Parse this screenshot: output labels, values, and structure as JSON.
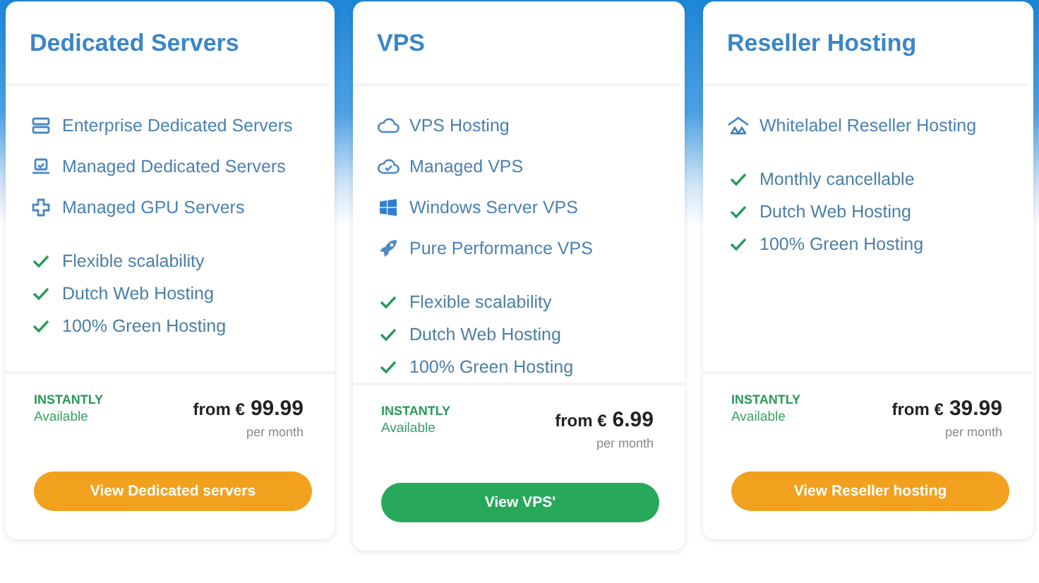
{
  "cards": [
    {
      "title": "Dedicated Servers",
      "services": [
        "Enterprise Dedicated Servers",
        "Managed Dedicated Servers",
        "Managed GPU Servers"
      ],
      "features": [
        "Flexible scalability",
        "Dutch Web Hosting",
        "100% Green Hosting"
      ],
      "availability": {
        "status": "INSTANTLY",
        "note": "Available"
      },
      "price_prefix": "from €",
      "price": "99.99",
      "period": "per month",
      "button": {
        "label": "View Dedicated servers",
        "color": "#f2a11f"
      }
    },
    {
      "title": "VPS",
      "services": [
        "VPS Hosting",
        "Managed VPS",
        "Windows Server VPS",
        "Pure Performance VPS"
      ],
      "features": [
        "Flexible scalability",
        "Dutch Web Hosting",
        "100% Green Hosting"
      ],
      "availability": {
        "status": "INSTANTLY",
        "note": "Available"
      },
      "price_prefix": "from €",
      "price": "6.99",
      "period": "per month",
      "button": {
        "label": "View VPS'",
        "color": "#28a85b"
      }
    },
    {
      "title": "Reseller Hosting",
      "services": [
        "Whitelabel Reseller Hosting"
      ],
      "features": [
        "Monthly cancellable",
        "Dutch Web Hosting",
        "100% Green Hosting"
      ],
      "availability": {
        "status": "INSTANTLY",
        "note": "Available"
      },
      "price_prefix": "from €",
      "price": "39.99",
      "period": "per month",
      "button": {
        "label": "View Reseller hosting",
        "color": "#f2a11f"
      }
    }
  ]
}
